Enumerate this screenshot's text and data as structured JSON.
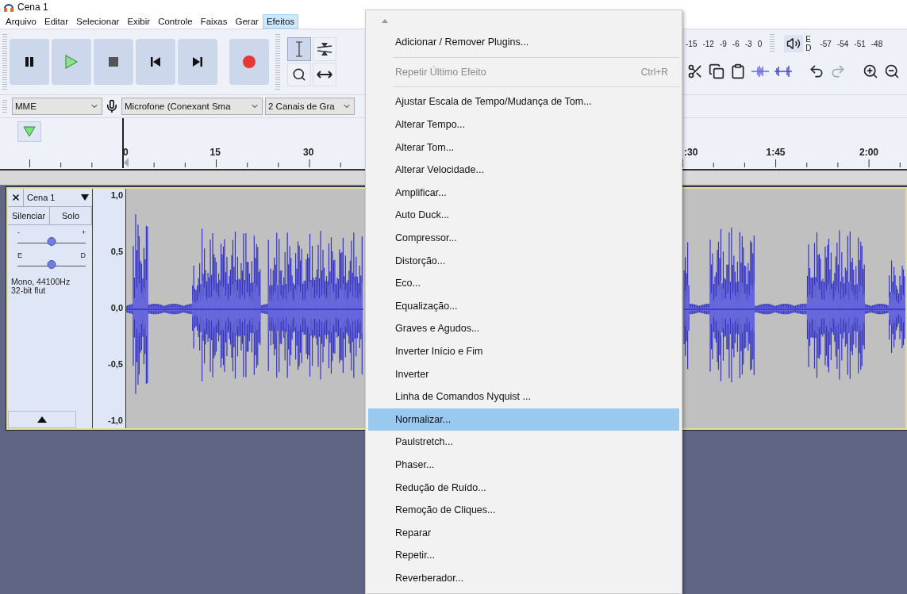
{
  "window": {
    "title": "Cena 1"
  },
  "menubar": [
    {
      "label": "Arquivo",
      "selected": false
    },
    {
      "label": "Editar",
      "selected": false
    },
    {
      "label": "Selecionar",
      "selected": false
    },
    {
      "label": "Exibir",
      "selected": false
    },
    {
      "label": "Controle",
      "selected": false
    },
    {
      "label": "Faixas",
      "selected": false
    },
    {
      "label": "Gerar",
      "selected": false
    },
    {
      "label": "Efeitos",
      "selected": true
    }
  ],
  "meters": {
    "record_scale": [
      "-15",
      "-12",
      "-9",
      "-6",
      "-3",
      "0"
    ],
    "playback_channels": [
      "E",
      "D"
    ],
    "playback_scale": [
      "-57",
      "-54",
      "-51",
      "-48"
    ]
  },
  "device_bar": {
    "host": "MME",
    "input_device": "Microfone (Conexant Sma",
    "channels": "2 Canais de  Gra"
  },
  "ruler": {
    "left_labels": [
      "0",
      "15",
      "30"
    ],
    "right_labels": [
      ":30",
      "1:45",
      "2:00"
    ]
  },
  "track": {
    "name": "Cena 1",
    "buttons": [
      "Silenciar",
      "Solo"
    ],
    "gain": {
      "min_label": "-",
      "max_label": "+",
      "level": 0.5
    },
    "pan": {
      "left_label": "E",
      "right_label": "D",
      "level": 0.5
    },
    "info": [
      "Mono, 44100Hz",
      "32-bit flut"
    ],
    "scale": [
      "1,0",
      "0,5",
      "0,0",
      "-0,5",
      "-1,0"
    ]
  },
  "effects_menu": {
    "items": [
      {
        "kind": "item",
        "label": "Adicionar / Remover Plugins...",
        "disabled": false,
        "selected": false
      },
      {
        "kind": "separator"
      },
      {
        "kind": "item",
        "label": "Repetir Último Efeito",
        "shortcut": "Ctrl+R",
        "disabled": true,
        "selected": false
      },
      {
        "kind": "separator"
      },
      {
        "kind": "item",
        "label": "Ajustar Escala de Tempo/Mudança de Tom...",
        "disabled": false,
        "selected": false
      },
      {
        "kind": "item",
        "label": "Alterar Tempo...",
        "disabled": false,
        "selected": false
      },
      {
        "kind": "item",
        "label": "Alterar Tom...",
        "disabled": false,
        "selected": false
      },
      {
        "kind": "item",
        "label": "Alterar Velocidade...",
        "disabled": false,
        "selected": false
      },
      {
        "kind": "item",
        "label": "Amplificar...",
        "disabled": false,
        "selected": false
      },
      {
        "kind": "item",
        "label": "Auto Duck...",
        "disabled": false,
        "selected": false
      },
      {
        "kind": "item",
        "label": "Compressor...",
        "disabled": false,
        "selected": false
      },
      {
        "kind": "item",
        "label": "Distorção...",
        "disabled": false,
        "selected": false
      },
      {
        "kind": "item",
        "label": "Eco...",
        "disabled": false,
        "selected": false
      },
      {
        "kind": "item",
        "label": "Equalização...",
        "disabled": false,
        "selected": false
      },
      {
        "kind": "item",
        "label": "Graves e Agudos...",
        "disabled": false,
        "selected": false
      },
      {
        "kind": "item",
        "label": "Inverter Início e Fim",
        "disabled": false,
        "selected": false
      },
      {
        "kind": "item",
        "label": "Inverter",
        "disabled": false,
        "selected": false
      },
      {
        "kind": "item",
        "label": "Linha de Comandos Nyquist ...",
        "disabled": false,
        "selected": false
      },
      {
        "kind": "item",
        "label": "Normalizar...",
        "disabled": false,
        "selected": true
      },
      {
        "kind": "item",
        "label": "Paulstretch...",
        "disabled": false,
        "selected": false
      },
      {
        "kind": "item",
        "label": "Phaser...",
        "disabled": false,
        "selected": false
      },
      {
        "kind": "item",
        "label": "Redução de Ruído...",
        "disabled": false,
        "selected": false
      },
      {
        "kind": "item",
        "label": "Remoção de Cliques...",
        "disabled": false,
        "selected": false
      },
      {
        "kind": "item",
        "label": "Reparar",
        "disabled": false,
        "selected": false
      },
      {
        "kind": "item",
        "label": "Repetir...",
        "disabled": false,
        "selected": false
      },
      {
        "kind": "item",
        "label": "Reverberador...",
        "disabled": false,
        "selected": false
      }
    ]
  }
}
